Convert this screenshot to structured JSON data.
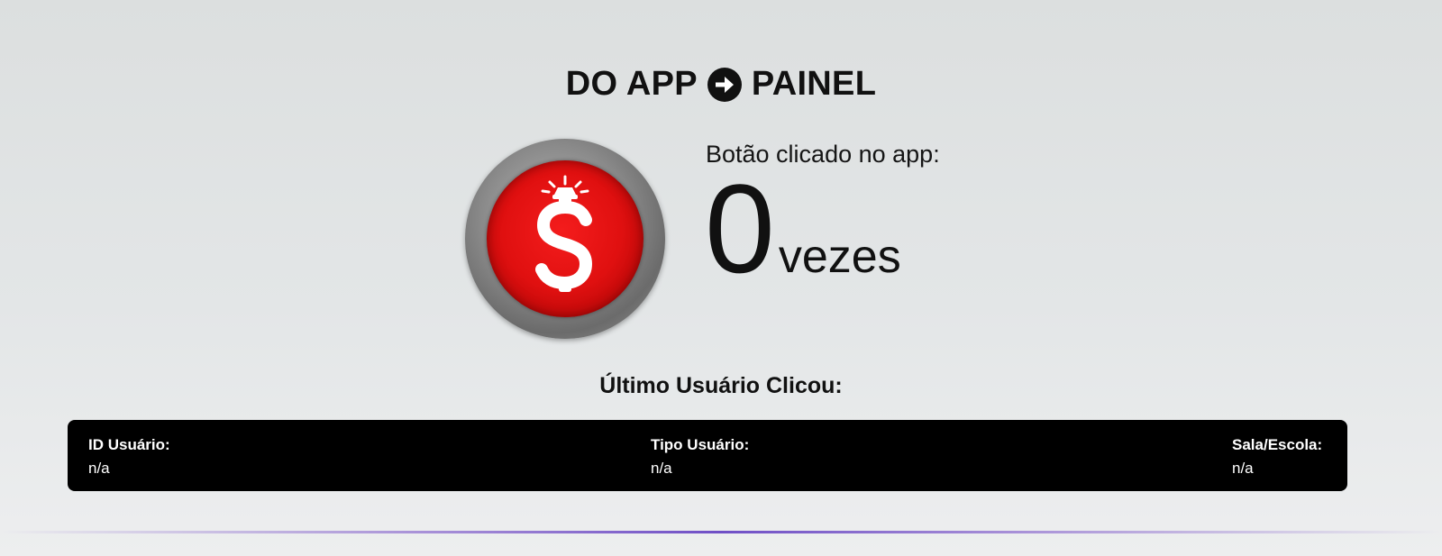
{
  "header": {
    "left": "DO APP",
    "icon": "arrow-right-circle-icon",
    "right": "PAINEL"
  },
  "counter": {
    "label": "Botão clicado no app:",
    "value": "0",
    "unit": "vezes",
    "button_icon": "dollar-bell-icon",
    "button_color": "#e01010"
  },
  "last_user": {
    "title": "Último Usuário Clicou:",
    "fields": [
      {
        "label": "ID Usuário:",
        "value": "n/a"
      },
      {
        "label": "Tipo Usuário:",
        "value": "n/a"
      },
      {
        "label": "Sala/Escola:",
        "value": "n/a"
      }
    ]
  },
  "colors": {
    "accent": "#6f4fc6",
    "panel": "#000000"
  }
}
